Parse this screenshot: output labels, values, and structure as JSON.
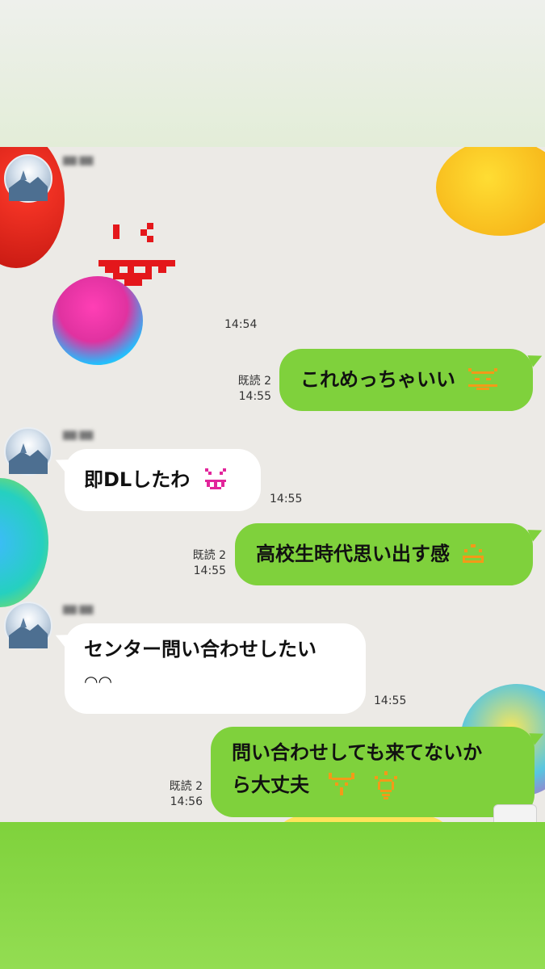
{
  "messages": [
    {
      "side": "in",
      "text": "即DLしたわ",
      "emoji": "grinning-face-icon",
      "time": "14:55"
    },
    {
      "side": "in",
      "text_line1": "センター問い合わせしたい",
      "text_line2": "◠◠",
      "time": "14:55"
    },
    {
      "side": "out",
      "text": "これめっちゃいい",
      "read": "既読 2",
      "time": "14:55"
    },
    {
      "side": "out",
      "text": "高校生時代思い出す感",
      "read": "既読 2",
      "time": "14:55"
    },
    {
      "side": "out",
      "text_line1": "問い合わせしても来てないか",
      "text_line2": "ら大丈夫",
      "read": "既読 2",
      "time": "14:56"
    }
  ],
  "sticker": {
    "name": "tongue-face-sticker",
    "time": "14:54"
  },
  "colors": {
    "bubble_out": "#7fd13c",
    "bubble_in": "#ffffff",
    "bottom_band": "#8ad748"
  }
}
